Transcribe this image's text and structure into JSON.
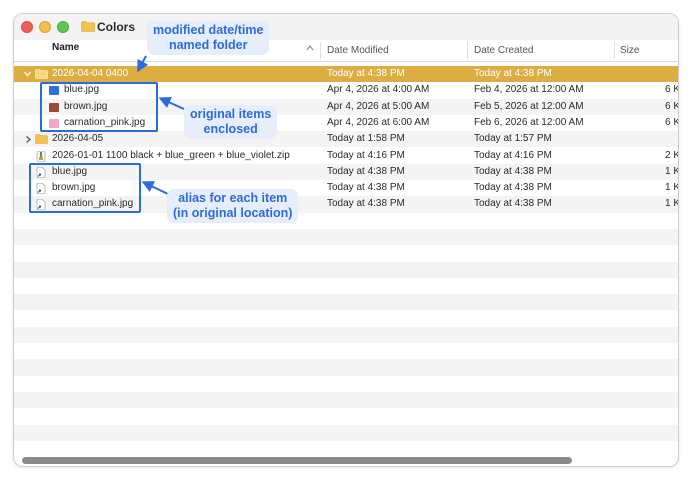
{
  "window": {
    "title": "Colors"
  },
  "columns": {
    "name": "Name",
    "modified": "Date Modified",
    "created": "Date Created",
    "size": "Size"
  },
  "rows": [
    {
      "name": "2026-04-04 0400",
      "modified": "Today at 4:38 PM",
      "created": "Today at 4:38 PM",
      "size": "",
      "kind": "folder",
      "expanded": true,
      "selected": true
    },
    {
      "name": "blue.jpg",
      "modified": "Apr 4, 2026 at 4:00 AM",
      "created": "Feb 4, 2026 at 12:00 AM",
      "size": "6 K",
      "kind": "image",
      "swatch": "#2f6fe0",
      "indent": 1
    },
    {
      "name": "brown.jpg",
      "modified": "Apr 4, 2026 at 5:00 AM",
      "created": "Feb 5, 2026 at 12:00 AM",
      "size": "6 K",
      "kind": "image",
      "swatch": "#9c4b33",
      "indent": 1
    },
    {
      "name": "carnation_pink.jpg",
      "modified": "Apr 4, 2026 at 6:00 AM",
      "created": "Feb 6, 2026 at 12:00 AM",
      "size": "6 K",
      "kind": "image",
      "swatch": "#f4a7c7",
      "indent": 1
    },
    {
      "name": "2026-04-05",
      "modified": "Today at 1:58 PM",
      "created": "Today at 1:57 PM",
      "size": "",
      "kind": "folder",
      "expanded": false
    },
    {
      "name": "2026-01-01 1100 black + blue_green + blue_violet.zip",
      "modified": "Today at 4:16 PM",
      "created": "Today at 4:16 PM",
      "size": "2 K",
      "kind": "zip"
    },
    {
      "name": "blue.jpg",
      "modified": "Today at 4:38 PM",
      "created": "Today at 4:38 PM",
      "size": "1 K",
      "kind": "alias"
    },
    {
      "name": "brown.jpg",
      "modified": "Today at 4:38 PM",
      "created": "Today at 4:38 PM",
      "size": "1 K",
      "kind": "alias"
    },
    {
      "name": "carnation_pink.jpg",
      "modified": "Today at 4:38 PM",
      "created": "Today at 4:38 PM",
      "size": "1 K",
      "kind": "alias"
    }
  ],
  "annotations": {
    "folder_note_line1": "modified date/time",
    "folder_note_line2": "named folder",
    "enclosed_note_line1": "original items",
    "enclosed_note_line2": "enclosed",
    "alias_note_line1": "alias for each item",
    "alias_note_line2": "(in original location)"
  },
  "colors": {
    "selection": "#dcae42",
    "annotation": "#2d6bdd",
    "annotation_bg": "#e7eefb",
    "folder": "#f2c24e"
  }
}
